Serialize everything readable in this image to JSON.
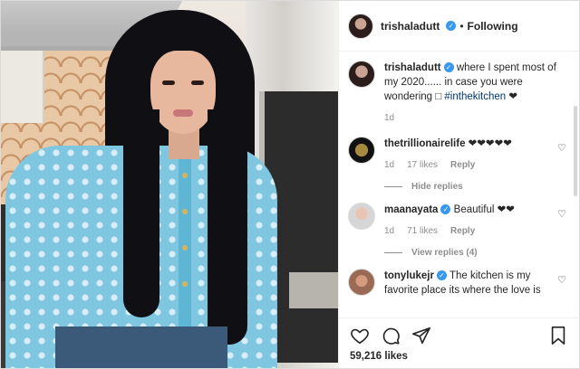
{
  "post": {
    "author": "trishaladutt",
    "follow_status": "Following",
    "separator": "•",
    "likes_count": "59,216 likes"
  },
  "caption": {
    "username": "trishaladutt",
    "text": " where I spent most of my 2020...... in case you were wondering □ ",
    "hashtag": "#inthekitchen",
    "emoji": " ❤",
    "time": "1d"
  },
  "comments": [
    {
      "username": "thetrillionairelife",
      "text": " ❤❤❤❤❤",
      "time": "1d",
      "likes": "17 likes",
      "reply": "Reply",
      "replies_toggle": "Hide replies"
    },
    {
      "username": "maanayata",
      "text": " Beautiful ❤❤",
      "time": "1d",
      "likes": "71 likes",
      "reply": "Reply",
      "replies_toggle": "View replies (4)"
    },
    {
      "username": "tonylukejr",
      "text": " The kitchen is my favorite place its where the love is"
    }
  ],
  "icons": {
    "verified": "✓",
    "heart": "♡"
  }
}
